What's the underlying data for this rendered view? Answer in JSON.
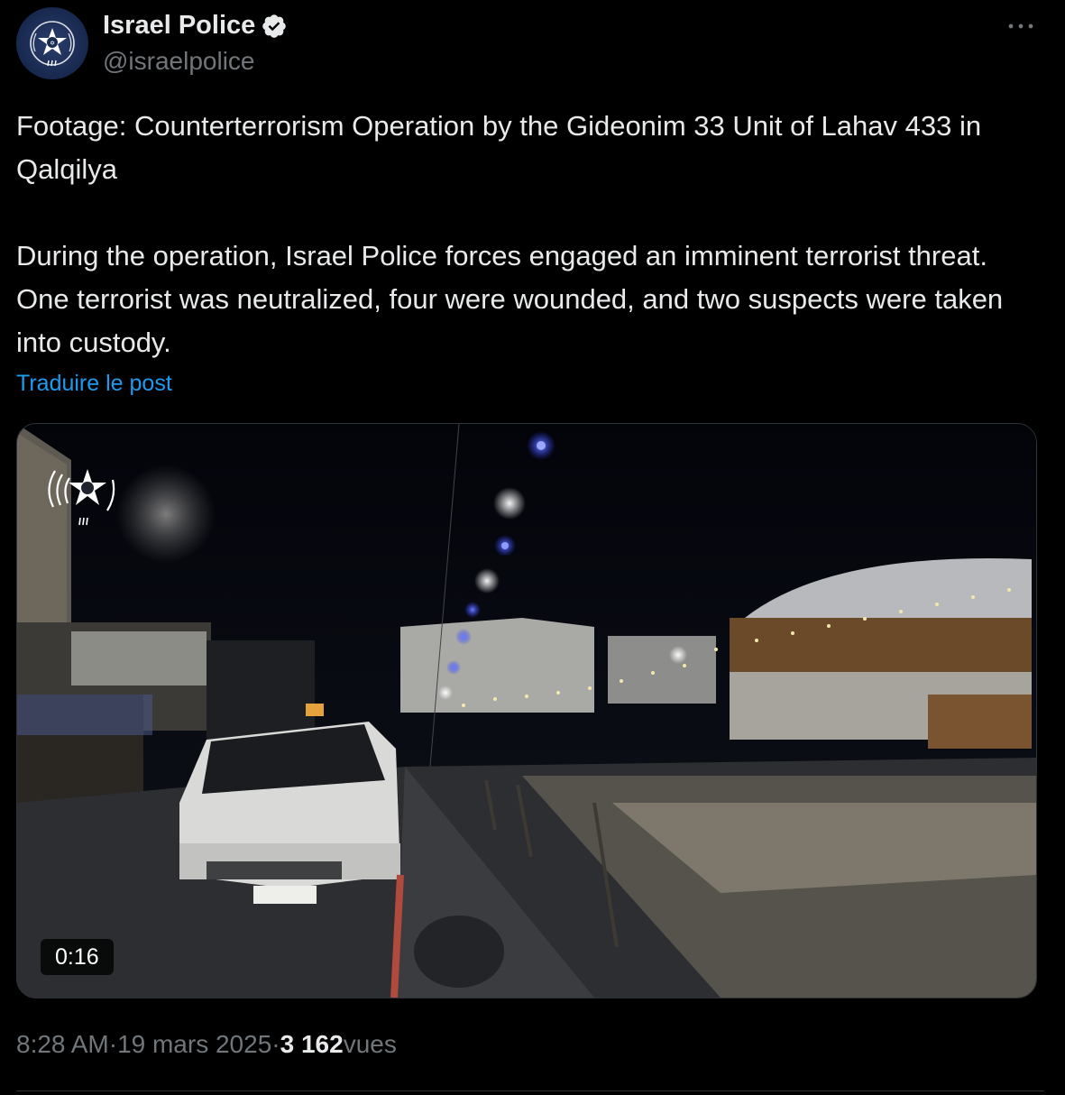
{
  "author": {
    "display_name": "Israel Police",
    "handle": "@israelpolice",
    "verified": true
  },
  "post": {
    "paragraph_1": "Footage: Counterterrorism Operation by the Gideonim 33 Unit of Lahav 433 in Qalqilya",
    "paragraph_2": "During the operation, Israel Police forces engaged an imminent terrorist threat. One terrorist was neutralized, four were wounded, and two suspects were taken into custody.",
    "translate_label": "Traduire le post"
  },
  "media": {
    "duration": "0:16",
    "type": "video"
  },
  "meta": {
    "time": "8:28 AM",
    "separator": " · ",
    "date": "19 mars 2025",
    "views_count": "3 162",
    "views_label": " vues"
  },
  "colors": {
    "background": "#000000",
    "text": "#e7e9ea",
    "secondary": "#71767b",
    "link": "#1d9bf0",
    "border": "#2f3336"
  },
  "icons": {
    "verified": "verified-badge-icon",
    "more": "more-options-icon",
    "avatar": "police-emblem"
  }
}
